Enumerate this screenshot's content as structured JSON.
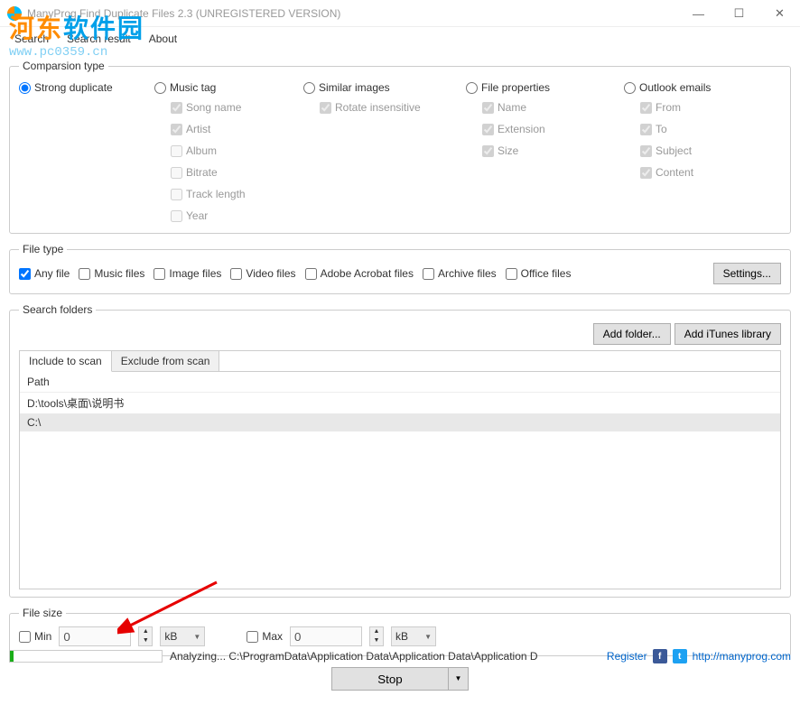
{
  "window": {
    "title": "ManyProg Find Duplicate Files 2.3 (UNREGISTERED VERSION)"
  },
  "watermark": {
    "text1": "河东",
    "text2": "软件园",
    "url": "www.pc0359.cn"
  },
  "menu": {
    "search": "Search",
    "search_result": "Search result",
    "about": "About"
  },
  "comparison": {
    "legend": "Comparsion type",
    "strong": "Strong duplicate",
    "music": {
      "label": "Music tag",
      "song_name": "Song name",
      "artist": "Artist",
      "album": "Album",
      "bitrate": "Bitrate",
      "track_length": "Track length",
      "year": "Year"
    },
    "similar": {
      "label": "Similar images",
      "rotate": "Rotate insensitive"
    },
    "fileprops": {
      "label": "File properties",
      "name": "Name",
      "extension": "Extension",
      "size": "Size"
    },
    "outlook": {
      "label": "Outlook emails",
      "from": "From",
      "to": "To",
      "subject": "Subject",
      "content": "Content"
    }
  },
  "filetype": {
    "legend": "File type",
    "any": "Any file",
    "music": "Music files",
    "image": "Image files",
    "video": "Video files",
    "acrobat": "Adobe Acrobat files",
    "archive": "Archive files",
    "office": "Office files",
    "settings": "Settings..."
  },
  "searchfolders": {
    "legend": "Search folders",
    "add_folder": "Add folder...",
    "add_itunes": "Add iTunes library",
    "tab_include": "Include to scan",
    "tab_exclude": "Exclude from scan",
    "header": "Path",
    "paths": [
      "D:\\tools\\桌面\\说明书",
      "C:\\"
    ]
  },
  "filesize": {
    "legend": "File size",
    "min": "Min",
    "max": "Max",
    "min_val": "0",
    "max_val": "0",
    "unit": "kB"
  },
  "action": {
    "stop": "Stop"
  },
  "status": {
    "analyzing": "Analyzing... C:\\ProgramData\\Application Data\\Application Data\\Application D",
    "register": "Register",
    "url": "http://manyprog.com"
  }
}
